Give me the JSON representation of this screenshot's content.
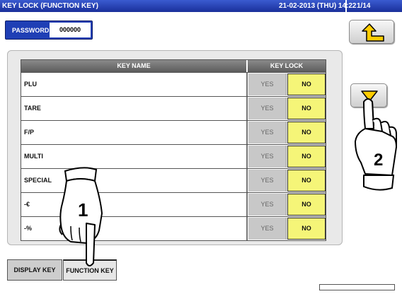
{
  "header": {
    "title": "KEY LOCK (FUNCTION KEY)",
    "datetime": "21-02-2013 (THU) 14:22",
    "page": "1/14"
  },
  "password": {
    "label": "PASSWORD",
    "value": "000000"
  },
  "toolbar": {
    "back_icon": "return-arrow-icon",
    "page_down_icon": "triangle-down-icon"
  },
  "table": {
    "headers": {
      "key_name": "KEY NAME",
      "key_lock": "KEY LOCK"
    },
    "rows": [
      {
        "name": "PLU",
        "yes": "YES",
        "no": "NO",
        "selected": "NO"
      },
      {
        "name": "TARE",
        "yes": "YES",
        "no": "NO",
        "selected": "NO"
      },
      {
        "name": "F/P",
        "yes": "YES",
        "no": "NO",
        "selected": "NO"
      },
      {
        "name": "MULTI",
        "yes": "YES",
        "no": "NO",
        "selected": "NO"
      },
      {
        "name": "SPECIAL",
        "yes": "YES",
        "no": "NO",
        "selected": "NO"
      },
      {
        "name": "-€",
        "yes": "YES",
        "no": "NO",
        "selected": "NO"
      },
      {
        "name": "-%",
        "yes": "YES",
        "no": "NO",
        "selected": "NO"
      }
    ]
  },
  "tabs": {
    "display_key": "DISPLAY KEY",
    "function_key": "FUNCTION KEY",
    "active": "FUNCTION KEY"
  },
  "annotations": {
    "step1": "1",
    "step2": "2"
  },
  "colors": {
    "title_bar": "#1f3fb5",
    "selected_no": "#f5f578",
    "unselected_yes": "#c8c8c8",
    "back_arrow": "#ffcc00"
  }
}
